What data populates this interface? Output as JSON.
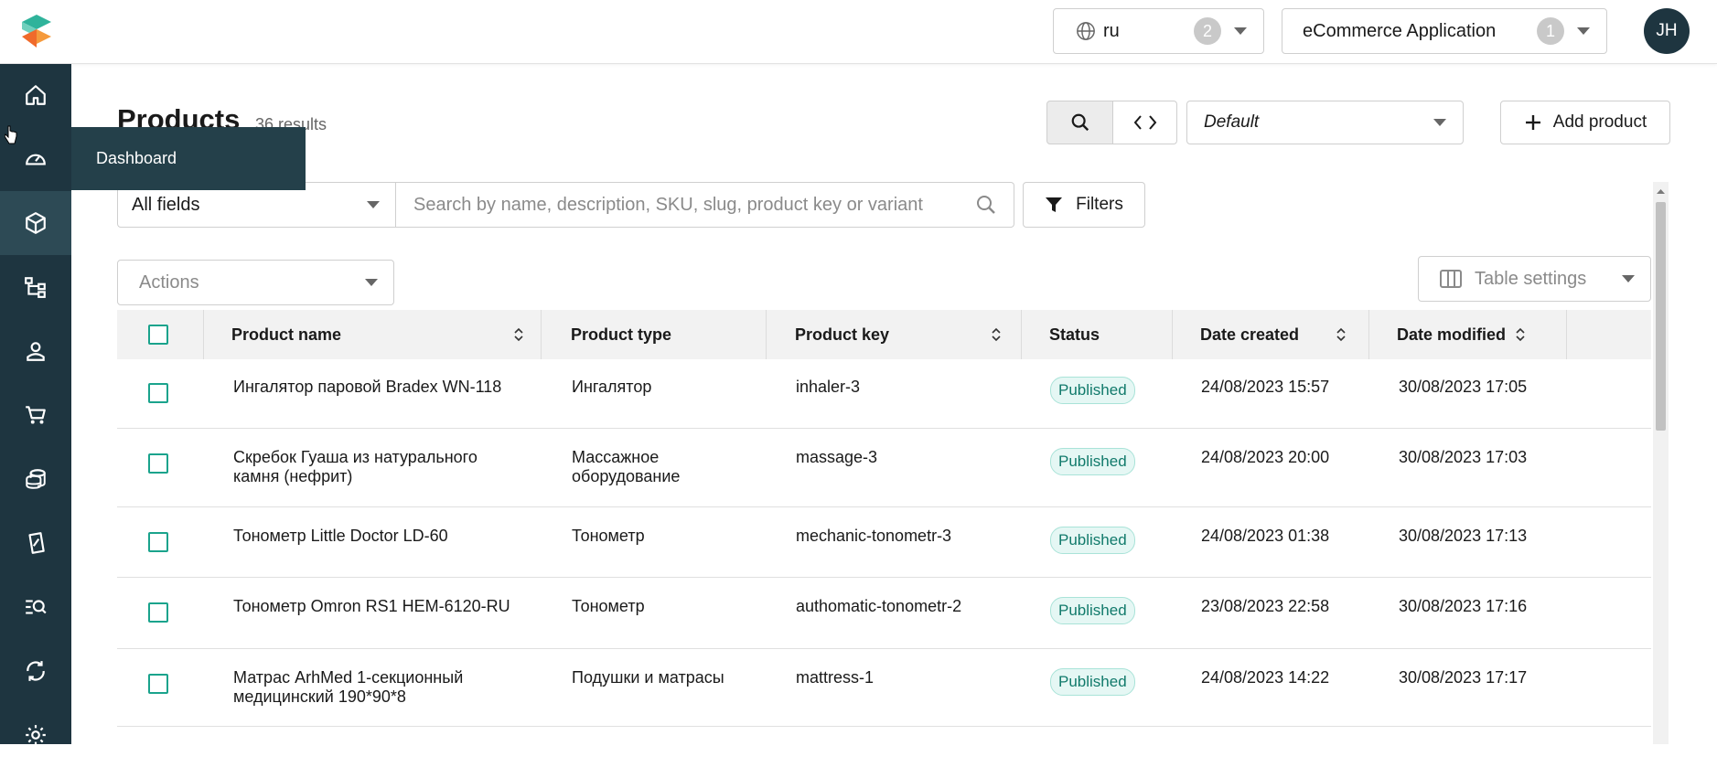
{
  "header": {
    "language": {
      "value": "ru",
      "count": "2"
    },
    "project": {
      "name": "eCommerce Application",
      "count": "1"
    },
    "user_initials": "JH"
  },
  "sidebar": {
    "items": [
      {
        "icon": "home-icon"
      },
      {
        "icon": "dashboard-gauge-icon",
        "tooltip": "Dashboard"
      },
      {
        "icon": "product-box-icon"
      },
      {
        "icon": "categories-tree-icon"
      },
      {
        "icon": "customer-person-icon"
      },
      {
        "icon": "cart-icon"
      },
      {
        "icon": "coins-icon"
      },
      {
        "icon": "discount-icon"
      },
      {
        "icon": "search-list-icon"
      },
      {
        "icon": "sync-icon"
      },
      {
        "icon": "gear-icon"
      }
    ]
  },
  "page": {
    "title": "Products",
    "results": "36 results",
    "view_selector": "Default",
    "add_button": "Add product"
  },
  "search": {
    "field_scope": "All fields",
    "placeholder": "Search by name, description, SKU, slug, product key or variant",
    "filters_label": "Filters"
  },
  "actions": {
    "label": "Actions",
    "table_settings": "Table settings"
  },
  "table": {
    "columns": [
      "Product name",
      "Product type",
      "Product key",
      "Status",
      "Date created",
      "Date modified"
    ],
    "rows": [
      {
        "name": "Ингалятор паровой Bradex WN-118",
        "type": "Ингалятор",
        "key": "inhaler-3",
        "status": "Published",
        "created": "24/08/2023 15:57",
        "modified": "30/08/2023 17:05"
      },
      {
        "name": "Скребок Гуаша из натурального камня (нефрит)",
        "type": "Массажное оборудование",
        "key": "massage-3",
        "status": "Published",
        "created": "24/08/2023 20:00",
        "modified": "30/08/2023 17:03"
      },
      {
        "name": "Тонометр Little Doctor LD-60",
        "type": "Тонометр",
        "key": "mechanic-tonometr-3",
        "status": "Published",
        "created": "24/08/2023 01:38",
        "modified": "30/08/2023 17:13"
      },
      {
        "name": "Тонометр Omron RS1 HEM-6120-RU",
        "type": "Тонометр",
        "key": "authomatic-tonometr-2",
        "status": "Published",
        "created": "23/08/2023 22:58",
        "modified": "30/08/2023 17:16"
      },
      {
        "name": "Матрас ArhMed 1-секционный медицинский 190*90*8",
        "type": "Подушки и матрасы",
        "key": "mattress-1",
        "status": "Published",
        "created": "24/08/2023 14:22",
        "modified": "30/08/2023 17:17"
      }
    ]
  },
  "colors": {
    "sidebar": "#1e3540",
    "accent": "#1aa38c",
    "published_bg": "#e5f7f4"
  }
}
